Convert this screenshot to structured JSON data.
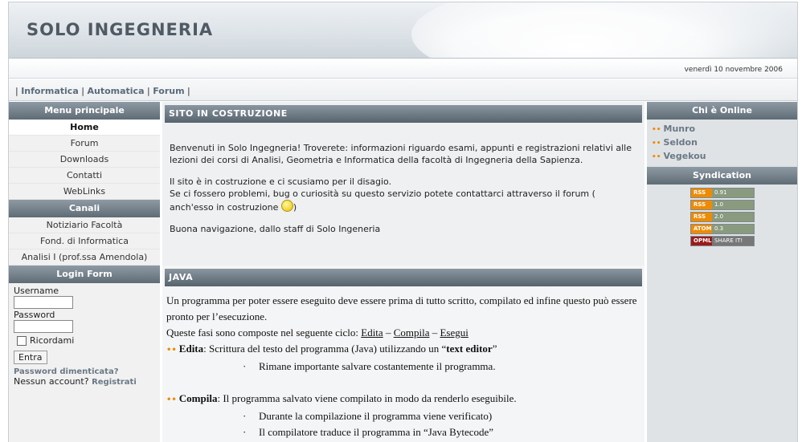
{
  "header": {
    "site_title": "SOLO INGEGNERIA",
    "date": "venerdì 10 novembre 2006"
  },
  "topnav": {
    "items": [
      "Informatica",
      "Automatica",
      "Forum"
    ]
  },
  "left": {
    "menu_title": "Menu principale",
    "menu_items": [
      "Home",
      "Forum",
      "Downloads",
      "Contatti",
      "WebLinks"
    ],
    "canali_title": "Canali",
    "canali_items": [
      "Notiziario Facoltà",
      "Fond. di Informatica",
      "Analisi I (prof.ssa Amendola)"
    ],
    "login": {
      "title": "Login Form",
      "username_label": "Username",
      "password_label": "Password",
      "remember_label": "Ricordami",
      "submit_label": "Entra",
      "forgot_label": "Password dimenticata?",
      "no_account_label": "Nessun account?",
      "register_label": "Registrati"
    }
  },
  "main": {
    "article1": {
      "title": "SITO IN COSTRUZIONE",
      "p1": "Benvenuti in Solo Ingegneria!  Troverete: informazioni riguardo esami, appunti e registrazioni relativi alle lezioni dei corsi di Analisi, Geometria e Informatica della facoltà di Ingegneria della Sapienza.",
      "p2_line1": "Il sito è in costruzione e ci scusiamo per il disagio.",
      "p2_line2": "Se ci fossero problemi, bug o curiosità su questo servizio potete contattarci attraverso il forum ( anch'esso in costruzione",
      "p2_end": ")",
      "p3": "Buona navigazione, dallo staff di Solo Ingeneria"
    },
    "article2": {
      "title": "JAVA",
      "intro": "Un programma per poter essere eseguito deve essere prima di tutto scritto, compilato ed infine questo può essere pronto per l’esecuzione.",
      "cycle_prefix": "Queste fasi sono composte nel seguente ciclo: ",
      "cycle_steps": [
        "Edita",
        "Compila",
        "Esegui"
      ],
      "cycle_sep": " – ",
      "edita_label": "Edita",
      "edita_text": ": Scrittura del testo del programma (Java) utilizzando un “",
      "edita_bold": "text editor",
      "edita_close": "”",
      "edita_sub": "Rimane importante salvare costantemente il programma.",
      "compila_label": "Compila",
      "compila_text": ": Il programma salvato viene compilato in modo da renderlo eseguibile.",
      "compila_sub1": "Durante la compilazione il programma viene verificato)",
      "compila_sub2": "Il compilatore traduce il programma in “Java Bytecode”",
      "sub_bullet": "·"
    }
  },
  "right": {
    "online_title": "Chi è Online",
    "online_users": [
      "Munro",
      "Seldon",
      "Vegekou"
    ],
    "syndication_title": "Syndication",
    "feeds": [
      {
        "left": "RSS",
        "right": "0.91"
      },
      {
        "left": "RSS",
        "right": "1.0"
      },
      {
        "left": "RSS",
        "right": "2.0"
      },
      {
        "left": "ATOM",
        "right": "0.3"
      },
      {
        "left": "OPML",
        "right": "SHARE IT!"
      }
    ]
  }
}
